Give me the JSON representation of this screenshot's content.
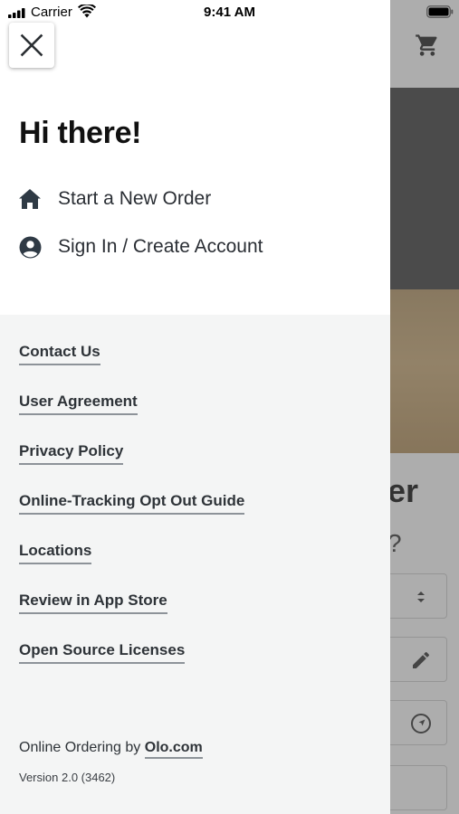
{
  "status_bar": {
    "carrier": "Carrier",
    "time": "9:41 AM"
  },
  "drawer": {
    "greeting": "Hi there!",
    "primary_items": [
      {
        "label": "Start a New Order",
        "icon": "home-icon"
      },
      {
        "label": "Sign In / Create Account",
        "icon": "account-circle-icon"
      }
    ],
    "links": [
      "Contact Us",
      "User Agreement",
      "Privacy Policy",
      "Online-Tracking Opt Out Guide",
      "Locations",
      "Review in App Store",
      "Open Source Licenses"
    ],
    "footer": {
      "prefix": "Online Ordering by",
      "link": "Olo.com",
      "version": "Version 2.0 (3462)"
    }
  },
  "background": {
    "title_fragment": "er",
    "subtitle_fragment": "?"
  },
  "colors": {
    "drawer_bottom_bg": "#f4f5f5",
    "text_primary": "#2e3338",
    "link_underline": "#8d9399",
    "icon_color": "#2f3a45"
  }
}
